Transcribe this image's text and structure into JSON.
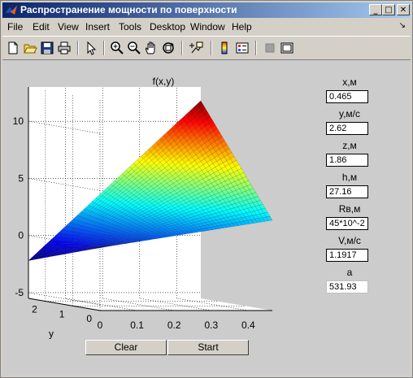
{
  "window": {
    "title": "Распространение мощности по поверхности"
  },
  "menu": [
    "File",
    "Edit",
    "View",
    "Insert",
    "Tools",
    "Desktop",
    "Window",
    "Help"
  ],
  "menu_grip": "↘",
  "titlebar_buttons": {
    "minimize": "_",
    "maximize": "□",
    "close": "✕"
  },
  "toolbar_icons": [
    "new-file-icon",
    "open-folder-icon",
    "save-icon",
    "print-icon",
    "pointer-icon",
    "zoom-in-icon",
    "zoom-out-icon",
    "pan-hand-icon",
    "rotate-3d-icon",
    "data-cursor-icon",
    "colorbar-icon",
    "legend-icon",
    "hide-tools-icon",
    "show-tools-icon"
  ],
  "parameters": [
    {
      "label": "x,м",
      "value": "0.465"
    },
    {
      "label": "y,м/c",
      "value": "2.62"
    },
    {
      "label": "z,м",
      "value": "1.86"
    },
    {
      "label": "h,м",
      "value": "27.16"
    },
    {
      "label": "Rв,м",
      "value": "45*10^-2"
    },
    {
      "label": "V,м/c",
      "value": "1.1917"
    },
    {
      "label": "a",
      "value": "531.93"
    }
  ],
  "buttons": {
    "clear": "Clear",
    "start": "Start"
  },
  "chart_data": {
    "type": "surface",
    "title": "f(x,y)",
    "xlabel": "",
    "ylabel": "y",
    "zlabel": "",
    "x_ticks": [
      "0",
      "0.1",
      "0.2",
      "0.3",
      "0.4"
    ],
    "y_ticks": [
      "0",
      "1",
      "2"
    ],
    "z_ticks": [
      "-5",
      "0",
      "5",
      "10"
    ],
    "xlim": [
      0,
      0.465
    ],
    "ylim": [
      0,
      2.62
    ],
    "zlim": [
      -5.5,
      13
    ],
    "grid": true,
    "colormap": "jet",
    "surface": {
      "x": [
        0,
        0.465
      ],
      "y": [
        0,
        2.62
      ],
      "z_corners": {
        "x0_y0": 0,
        "x0_y262": -2.2,
        "x0465_y0": 2.4,
        "x0465_y262": 11.8
      }
    }
  }
}
